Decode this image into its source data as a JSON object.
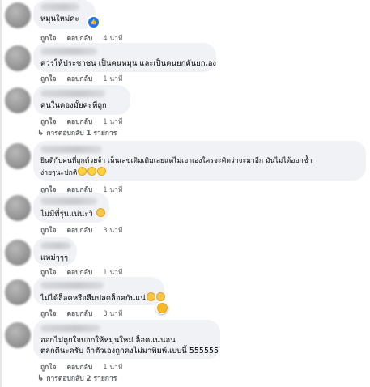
{
  "labels": {
    "like": "ถูกใจ",
    "reply": "ตอบกลับ"
  },
  "comments": [
    {
      "text": "หมุนใหม่คะ",
      "time": "4 นาที"
    },
    {
      "text": "ควรให้ประชาชน เป็นคนหมุน และเป็นคนยกคันยกเอง",
      "time": "1 นาที"
    },
    {
      "text": "คนในคองมั้ยคะที่ถูก",
      "time": "1 นาที",
      "replies": "การตอบกลับ 1 รายการ"
    },
    {
      "text_line1": "ยินดีกับคนที่ถูกด้วยจ้า เห็นเลขเดิมเดิมเลยแต่ไม่เอาเองใครจะคิดว่าจะมาอีก มันไม่ได้ออกซ้ำ",
      "text_line2": "ง่ายๆนะปกติ",
      "time": "1 นาที"
    },
    {
      "text": "ไม่มีที่รุ่นแน่นะวิ",
      "time": "3 นาที"
    },
    {
      "text": "แหม่ๆๆๆ",
      "time": "1 นาที"
    },
    {
      "text": "ไม่ได้ล็อคหรือลืมปลดล็อคกันแน่",
      "time": "3 นาที"
    },
    {
      "text_line1": "ออกไม่ถูกใจบอกให้หมุนใหม่ ล็อคแน่นอน",
      "text_line2": "ตลกดีนะครับ ถ้าตัวเองถูกคงไม่มาพิมพ์แบบนี้ 555555",
      "time": "1 นาที",
      "replies": "การตอบกลับ 2 รายการ"
    }
  ],
  "colors": {
    "bubble": "#f0f2f5",
    "meta": "#65676b",
    "like_badge": "#1877f2"
  }
}
